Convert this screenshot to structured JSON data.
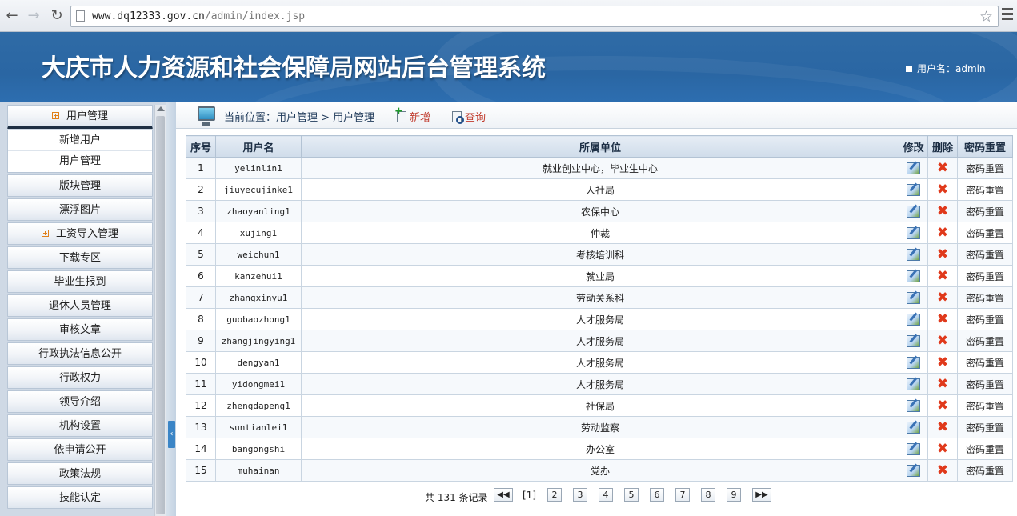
{
  "browser": {
    "back_icon": "back-arrow-icon",
    "forward_icon": "forward-arrow-icon",
    "reload_icon": "reload-icon",
    "url_host": "www.dq12333.gov.cn",
    "url_path": "/admin/index.jsp"
  },
  "header": {
    "title": "大庆市人力资源和社会保障局网站后台管理系统",
    "user_label": "用户名：admin"
  },
  "sidebar": {
    "user_menu_head": "用户管理",
    "user_menu_sub": [
      "新增用户",
      "用户管理"
    ],
    "items_a": [
      "版块管理",
      "漂浮图片"
    ],
    "salary_head": "工资导入管理",
    "items_b": [
      "下载专区",
      "毕业生报到",
      "退休人员管理",
      "审核文章",
      "行政执法信息公开",
      "行政权力",
      "领导介绍",
      "机构设置",
      "依申请公开",
      "政策法规",
      "技能认定"
    ]
  },
  "toolbar": {
    "breadcrumb": "当前位置：用户管理 > 用户管理",
    "new_label": "新增",
    "query_label": "查询"
  },
  "table": {
    "headers": [
      "序号",
      "用户名",
      "所属单位",
      "修改",
      "删除",
      "密码重置"
    ],
    "reset_label": "密码重置",
    "rows": [
      {
        "no": "1",
        "username": "yelinlin1",
        "unit": "就业创业中心，毕业生中心"
      },
      {
        "no": "2",
        "username": "jiuyecujinke1",
        "unit": "人社局"
      },
      {
        "no": "3",
        "username": "zhaoyanling1",
        "unit": "农保中心"
      },
      {
        "no": "4",
        "username": "xujing1",
        "unit": "仲裁"
      },
      {
        "no": "5",
        "username": "weichun1",
        "unit": "考核培训科"
      },
      {
        "no": "6",
        "username": "kanzehui1",
        "unit": "就业局"
      },
      {
        "no": "7",
        "username": "zhangxinyu1",
        "unit": "劳动关系科"
      },
      {
        "no": "8",
        "username": "guobaozhong1",
        "unit": "人才服务局"
      },
      {
        "no": "9",
        "username": "zhangjingying1",
        "unit": "人才服务局"
      },
      {
        "no": "10",
        "username": "dengyan1",
        "unit": "人才服务局"
      },
      {
        "no": "11",
        "username": "yidongmei1",
        "unit": "人才服务局"
      },
      {
        "no": "12",
        "username": "zhengdapeng1",
        "unit": "社保局"
      },
      {
        "no": "13",
        "username": "suntianlei1",
        "unit": "劳动监察"
      },
      {
        "no": "14",
        "username": "bangongshi",
        "unit": "办公室"
      },
      {
        "no": "15",
        "username": "muhainan",
        "unit": "党办"
      }
    ]
  },
  "pager": {
    "total_text": "共 131 条记录",
    "current": "[1]",
    "pages": [
      "2",
      "3",
      "4",
      "5",
      "6",
      "7",
      "8",
      "9"
    ],
    "prev_label": "◀◀",
    "next_label": "▶▶"
  }
}
